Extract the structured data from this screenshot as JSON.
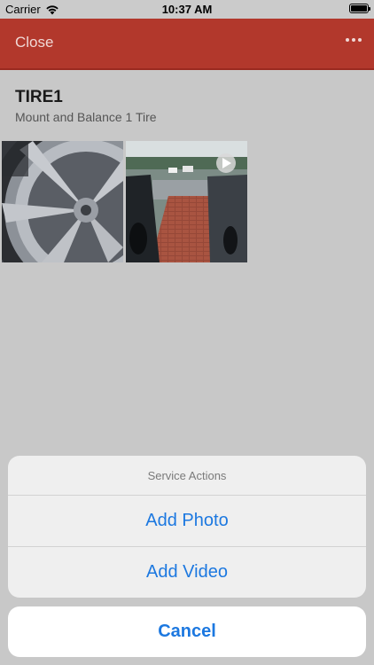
{
  "status_bar": {
    "carrier": "Carrier",
    "time": "10:37 AM"
  },
  "nav": {
    "close_label": "Close",
    "more_icon": "more-horizontal-icon",
    "background_color": "#b2382c"
  },
  "service": {
    "title": "TIRE1",
    "subtitle": "Mount and Balance 1 Tire",
    "media": [
      {
        "kind": "photo",
        "depicts": "wheel rim"
      },
      {
        "kind": "video",
        "depicts": "parking lot"
      }
    ]
  },
  "action_sheet": {
    "title": "Service Actions",
    "actions": [
      "Add Photo",
      "Add Video"
    ],
    "cancel_label": "Cancel",
    "accent_color": "#1c78e0"
  }
}
